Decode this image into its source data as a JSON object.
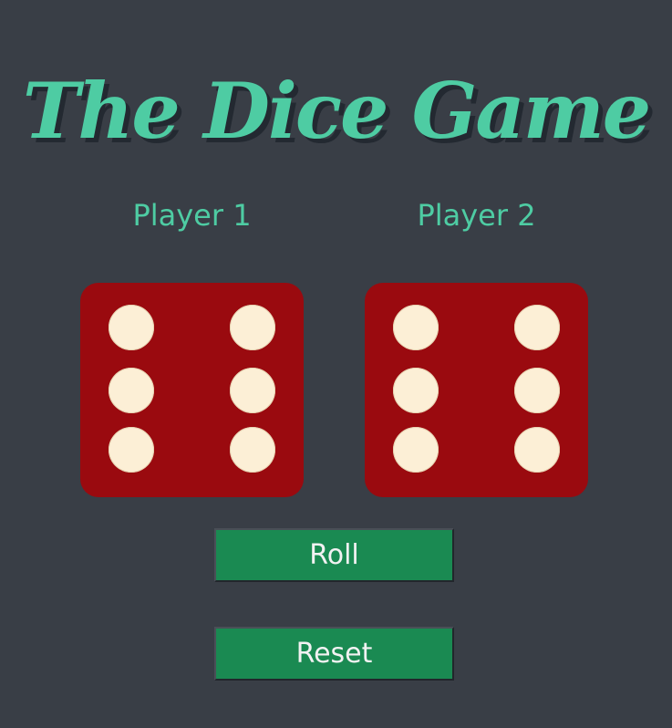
{
  "title": "The Dice Game",
  "players": [
    {
      "label": "Player 1",
      "die_value": 6
    },
    {
      "label": "Player 2",
      "die_value": 6
    }
  ],
  "buttons": {
    "roll_label": "Roll",
    "reset_label": "Reset"
  },
  "colors": {
    "background": "#393e46",
    "accent": "#4ecca3",
    "die": "#9a0a0f",
    "pip": "#fcefd6",
    "button": "#1a8a52"
  }
}
